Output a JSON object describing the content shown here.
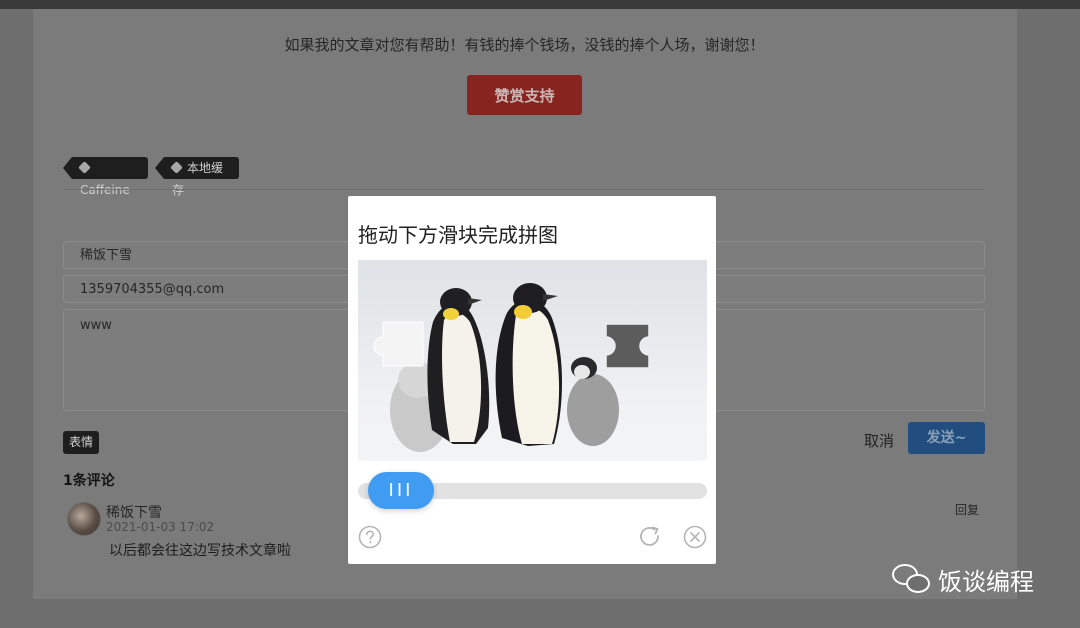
{
  "article": {
    "support_text": "如果我的文章对您有帮助！有钱的捧个钱场，没钱的捧个人场，谢谢您！",
    "support_button": "赞赏支持",
    "tags": [
      "Caffeine",
      "本地缓存"
    ]
  },
  "comment_form": {
    "name_value": "稀饭下雪",
    "email_value": "1359704355@qq.com",
    "content_value": "www",
    "emoji_button": "表情",
    "cancel_label": "取消",
    "send_label": "发送~"
  },
  "comments": {
    "count_label": "1条评论",
    "items": [
      {
        "author": "稀饭下雪",
        "date": "2021-01-03 17:02",
        "text": "以后都会往这边写技术文章啦",
        "reply_label": "回复"
      }
    ]
  },
  "captcha": {
    "title": "拖动下方滑块完成拼图",
    "slider_handle_label": "III",
    "slider_progress": 0.08,
    "icons": [
      "help-icon",
      "refresh-icon",
      "close-icon"
    ],
    "accent_color": "#3f9cf2"
  },
  "watermark": {
    "text": "饭谈编程"
  }
}
